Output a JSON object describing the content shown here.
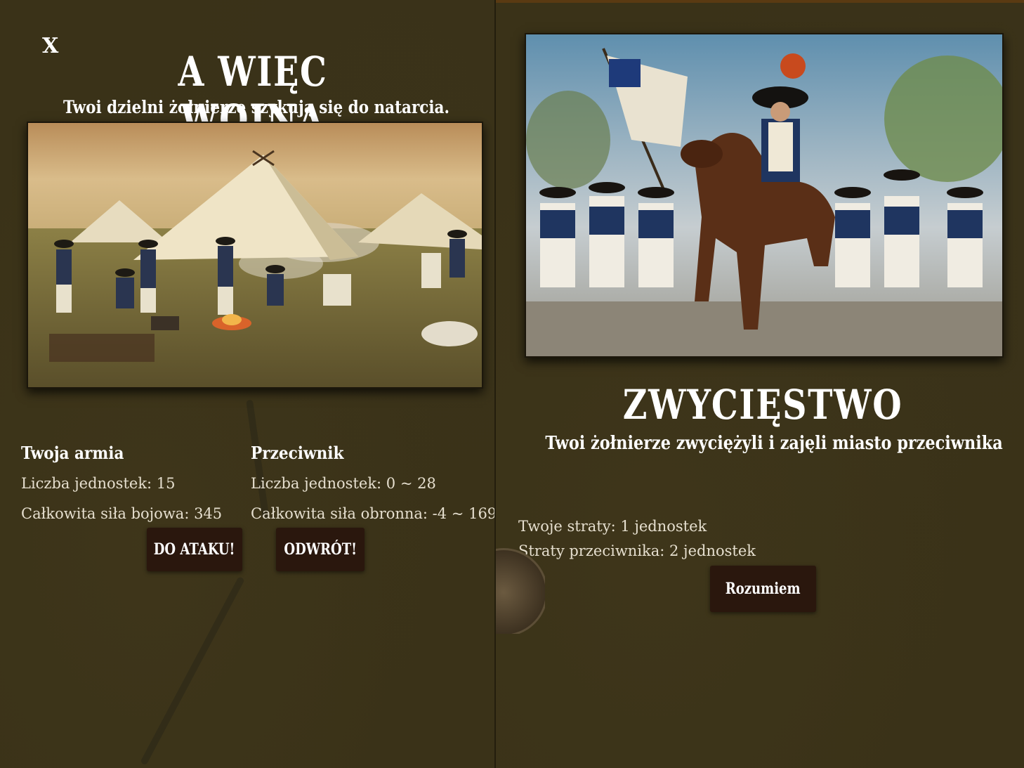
{
  "left_dialog": {
    "close_label": "X",
    "title": "A WIĘC WOJNA",
    "subtitle": "Twoi dzielni żołnierze szykują się do natarcia.",
    "scene_image": "army-camp-scene",
    "player": {
      "heading": "Twoja armia",
      "units": "Liczba jednostek: 15",
      "power": "Całkowita siła bojowa: 345"
    },
    "enemy": {
      "heading": "Przeciwnik",
      "units": "Liczba jednostek: 0 ~ 28",
      "power": "Całkowita siła obronna: -4 ~ 169"
    },
    "attack_button": "DO ATAKU!",
    "retreat_button": "ODWRÓT!"
  },
  "right_dialog": {
    "scene_image": "cavalry-charge-scene",
    "title": "ZWYCIĘSTWO",
    "subtitle": "Twoi żołnierze zwyciężyli i zajęli miasto przeciwnika",
    "losses_player": "Twoje straty: 1 jednostek",
    "losses_enemy": "Straty przeciwnika: 2 jednostek",
    "confirm_button": "Rozumiem"
  },
  "colors": {
    "background": "#3a3218",
    "button": "#2a170d",
    "text": "#ece4d2"
  }
}
